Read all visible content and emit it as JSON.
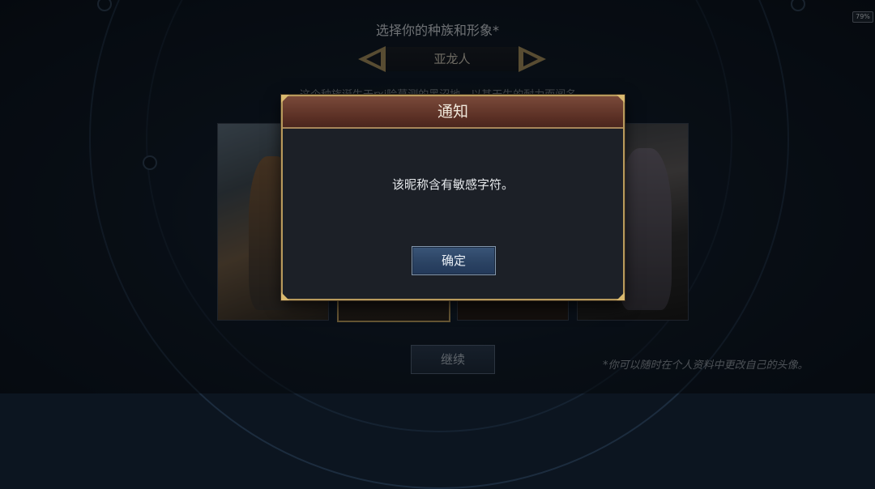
{
  "status_bar": {
    "battery": "79%"
  },
  "header": {
    "title": "选择你的种族和形象*",
    "race_name": "亚龙人",
    "prev_icon": "chevron-left-icon",
    "next_icon": "chevron-right-icon"
  },
  "description": "这个种族诞生于rxi险莫测的黑沼地，以其天生的耐力而闻名。",
  "portraits": [
    {
      "id": "portrait-1"
    },
    {
      "id": "portrait-2",
      "selected": true
    },
    {
      "id": "portrait-3"
    },
    {
      "id": "portrait-4"
    }
  ],
  "footer": {
    "continue_label": "继续",
    "hint": "*你可以随时在个人资料中更改自己的头像。"
  },
  "dialog": {
    "title": "通知",
    "message": "该昵称含有敏感字符。",
    "ok_label": "确定"
  },
  "colors": {
    "gold_border": "#b89a5c",
    "header_red": "#6a3a2e",
    "button_blue": "#2a4262"
  }
}
